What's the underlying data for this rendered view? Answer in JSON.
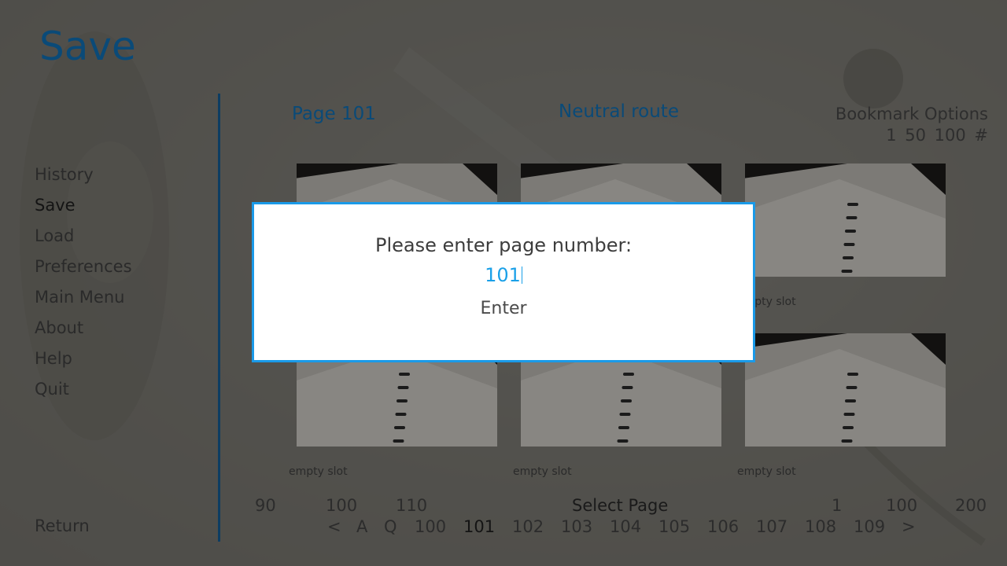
{
  "screen_title": "Save",
  "nav": {
    "items": [
      "History",
      "Save",
      "Load",
      "Preferences",
      "Main Menu",
      "About",
      "Help",
      "Quit"
    ],
    "active": "Save",
    "return_label": "Return"
  },
  "header": {
    "page_name": "Page 101",
    "route": "Neutral route",
    "bookmark_title": "Bookmark Options",
    "bookmark_options": "1 50 100 #"
  },
  "slots": [
    {
      "label": "empty slot"
    },
    {
      "label": "empty slot"
    },
    {
      "label": "empty slot"
    },
    {
      "label": "empty slot"
    },
    {
      "label": "empty slot"
    },
    {
      "label": "empty slot"
    }
  ],
  "visible_slot_labels": {
    "row1_col3": "empty slot",
    "row2_col1": "empty slot",
    "row2_col2": "empty slot",
    "row2_col3": "empty slot"
  },
  "pager": {
    "jump_left": [
      "90",
      "100",
      "110"
    ],
    "select_page_label": "Select Page",
    "jump_right": [
      "1",
      "100",
      "200"
    ],
    "prev": "<",
    "auto": "A",
    "quick": "Q",
    "pages": [
      "100",
      "101",
      "102",
      "103",
      "104",
      "105",
      "106",
      "107",
      "108",
      "109"
    ],
    "current": "101",
    "next": ">"
  },
  "dialog": {
    "prompt": "Please enter page number:",
    "value": "101",
    "enter_label": "Enter"
  },
  "colors": {
    "accent": "#1a9ae8",
    "title": "#0a4a78"
  }
}
